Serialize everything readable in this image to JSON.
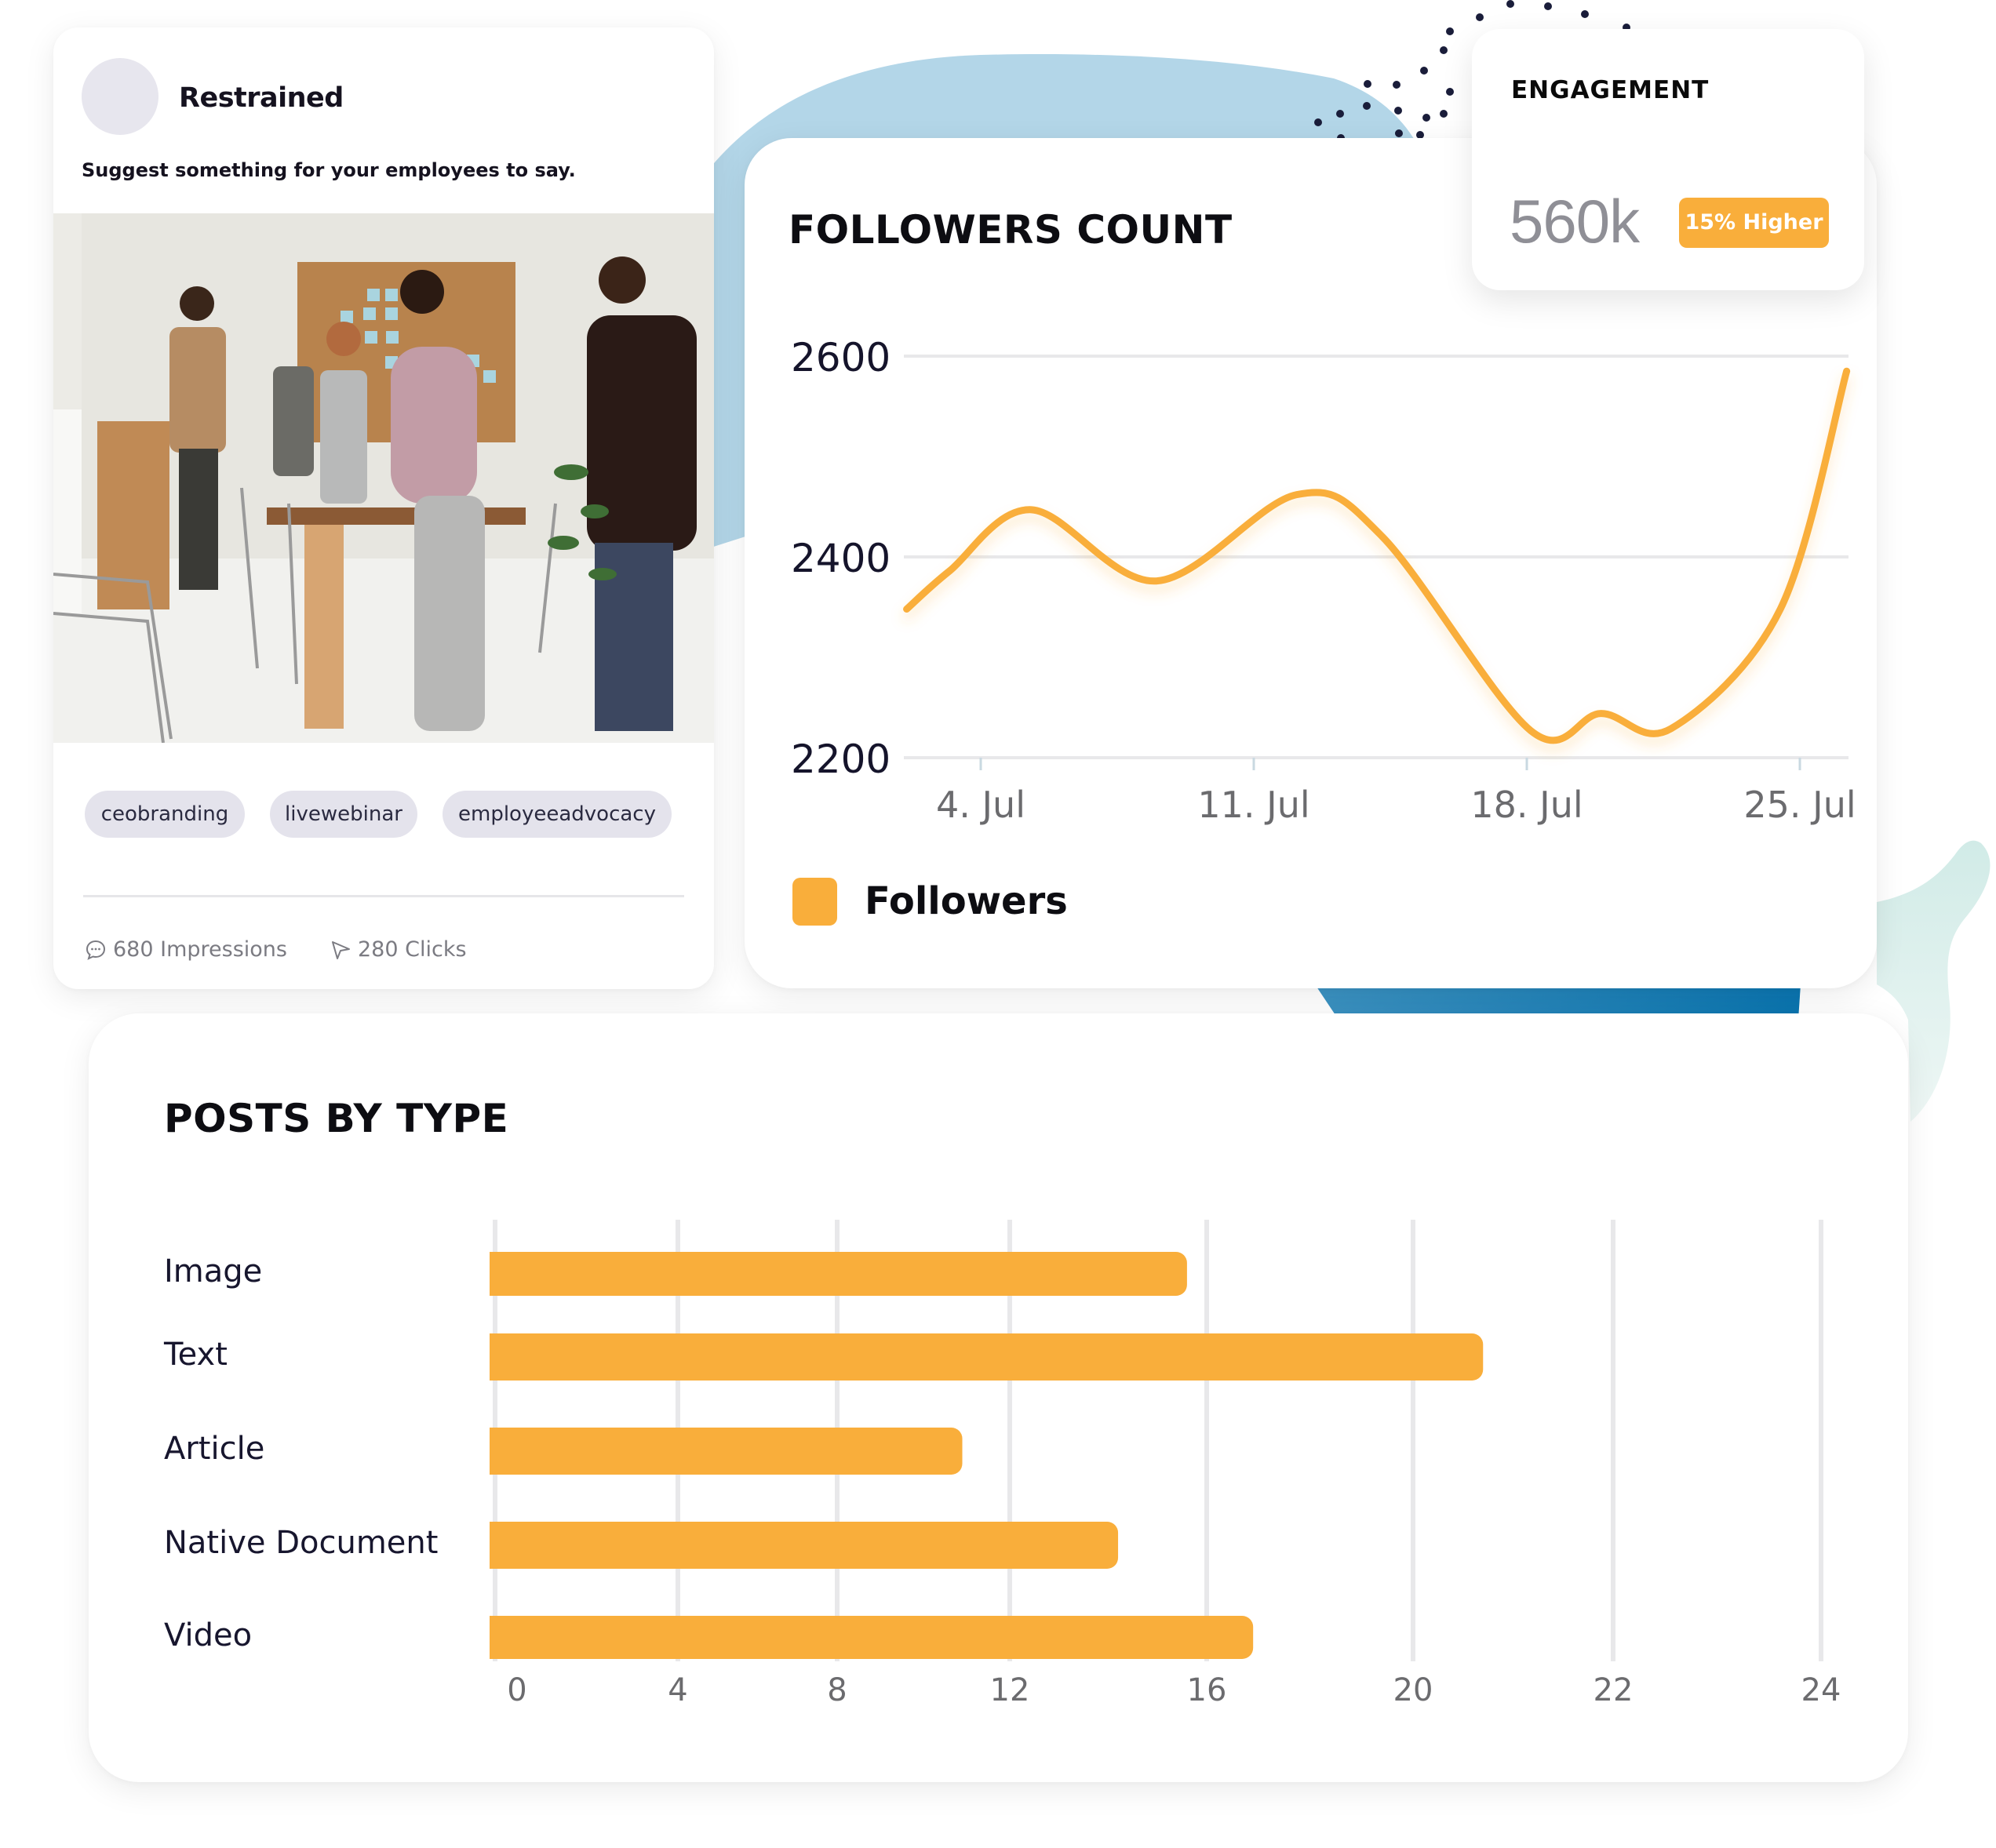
{
  "post": {
    "author": "Restrained",
    "prompt": "Suggest something for your employees to say.",
    "photo_alt": "office-team-photo",
    "tags": [
      "ceobranding",
      "livewebinar",
      "employeeadvocacy"
    ],
    "stats": {
      "impressions_label": "680 Impressions",
      "impressions_icon": "chat-bubble-icon",
      "clicks_label": "280 Clicks",
      "clicks_icon": "cursor-arrow-icon"
    }
  },
  "engagement": {
    "title": "ENGAGEMENT",
    "value": "560k",
    "badge": "15% Higher",
    "badge_color": "#f9ae3b"
  },
  "colors": {
    "accent": "#f9ae3b",
    "grid": "#e8e8ea",
    "text_dark": "#0d0d12",
    "tick_text": "#6b6b6e"
  },
  "chart_data": [
    {
      "type": "line",
      "title": "FOLLOWERS COUNT",
      "xlabel": "",
      "ylabel": "",
      "x_ticks": [
        "4. Jul",
        "11. Jul",
        "18. Jul",
        "25. Jul"
      ],
      "x_tick_days": [
        4,
        11,
        18,
        25
      ],
      "y_ticks": [
        2200,
        2400,
        2600
      ],
      "ylim": [
        2200,
        2600
      ],
      "xlim_days": [
        2,
        26.2
      ],
      "grid": true,
      "legend": {
        "position": "bottom-left",
        "entries": [
          "Followers"
        ]
      },
      "series": [
        {
          "name": "Followers",
          "color": "#f9ae3b",
          "points": [
            {
              "day": 2.1,
              "value": 2348
            },
            {
              "day": 3.2,
              "value": 2386
            },
            {
              "day": 5.3,
              "value": 2447
            },
            {
              "day": 8.5,
              "value": 2376
            },
            {
              "day": 12.1,
              "value": 2462
            },
            {
              "day": 14.3,
              "value": 2420
            },
            {
              "day": 18.1,
              "value": 2227
            },
            {
              "day": 19.9,
              "value": 2244
            },
            {
              "day": 21.7,
              "value": 2229
            },
            {
              "day": 24.5,
              "value": 2348
            },
            {
              "day": 26.2,
              "value": 2585
            }
          ]
        }
      ]
    },
    {
      "type": "bar",
      "orientation": "horizontal",
      "title": "POSTS BY TYPE",
      "categories": [
        "Image",
        "Text",
        "Article",
        "Native Document",
        "Video"
      ],
      "values": [
        15.6,
        20.7,
        10.9,
        14.2,
        16.9
      ],
      "x_ticks": [
        0,
        4,
        8,
        12,
        16,
        20,
        22,
        24
      ],
      "xlim": [
        0,
        24
      ],
      "grid": true,
      "color": "#f9ae3b",
      "legend": null
    }
  ]
}
